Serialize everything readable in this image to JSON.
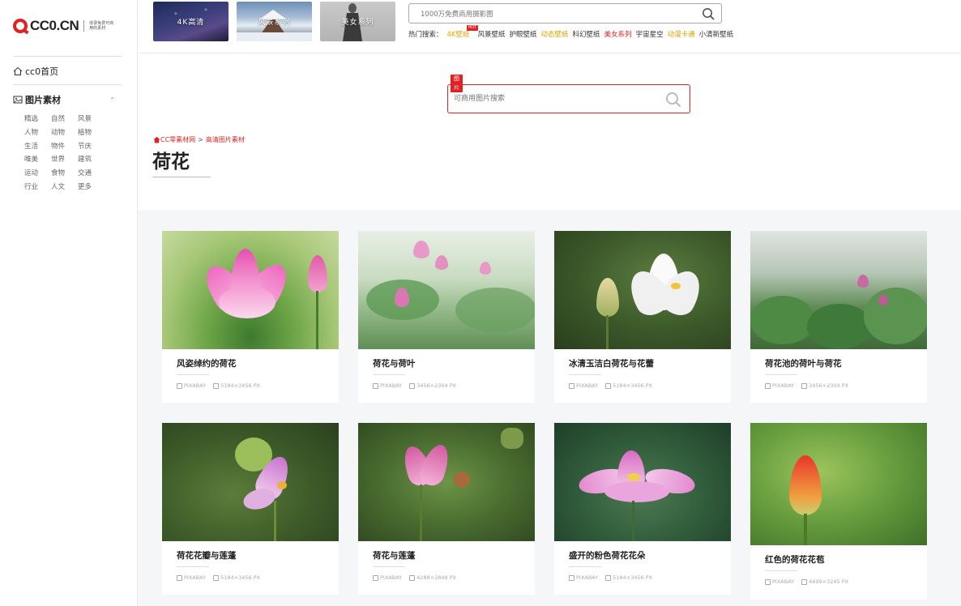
{
  "logo": {
    "text": "CC0.CN",
    "slogan": "收录免费可商用的素材"
  },
  "sidebar": {
    "home_label": "cc0首页",
    "category_label": "图片素材",
    "tags": [
      "精选",
      "自然",
      "风景",
      "人物",
      "动物",
      "植物",
      "生活",
      "物件",
      "节庆",
      "唯美",
      "世界",
      "建筑",
      "运动",
      "食物",
      "交通",
      "行业",
      "人文",
      "更多"
    ]
  },
  "top": {
    "thumbs": [
      {
        "label": "4K高清"
      },
      {
        "label": "风景系列"
      },
      {
        "label": "美女系列"
      }
    ],
    "search_placeholder": "1000万免费商用摄影图",
    "hot_prefix": "热门搜索：",
    "hot_items": [
      {
        "label": "4K壁纸",
        "style": "orange",
        "badge": "HOT"
      },
      {
        "label": "风景壁纸",
        "style": ""
      },
      {
        "label": "护眼壁纸",
        "style": ""
      },
      {
        "label": "动态壁纸",
        "style": "gold"
      },
      {
        "label": "科幻壁纸",
        "style": ""
      },
      {
        "label": "美女系列",
        "style": "red"
      },
      {
        "label": "宇宙星空",
        "style": ""
      },
      {
        "label": "动漫卡通",
        "style": "gold"
      },
      {
        "label": "小清新壁纸",
        "style": ""
      }
    ]
  },
  "search": {
    "tag": "图片",
    "placeholder": "可商用图片搜索"
  },
  "breadcrumb": {
    "home": "CC零素材网",
    "separator": ">",
    "current": "高清图片素材"
  },
  "page_title": "荷花",
  "cards": [
    {
      "title": "风姿绰约的荷花",
      "source": "PIXABAY",
      "size": "5184×3456 PX"
    },
    {
      "title": "荷花与荷叶",
      "source": "PIXABAY",
      "size": "3456×2304 PX"
    },
    {
      "title": "冰清玉洁白荷花与花蕾",
      "source": "PIXABAY",
      "size": "5184×3456 PX"
    },
    {
      "title": "荷花池的荷叶与荷花",
      "source": "PIXABAY",
      "size": "3456×2304 PX"
    },
    {
      "title": "荷花花瓣与莲蓬",
      "source": "PIXABAY",
      "size": "5184×3456 PX"
    },
    {
      "title": "荷花与莲蓬",
      "source": "PIXABAY",
      "size": "4288×2848 PX"
    },
    {
      "title": "盛开的粉色荷花花朵",
      "source": "PIXABAY",
      "size": "5184×3456 PX"
    },
    {
      "title": "红色的荷花花苞",
      "source": "PIXABAY",
      "size": "4699×3245 PX"
    }
  ],
  "colors": {
    "brand": "#e02222",
    "hot_orange": "#e8a500",
    "gallery_bg": "#f5f6f8"
  }
}
